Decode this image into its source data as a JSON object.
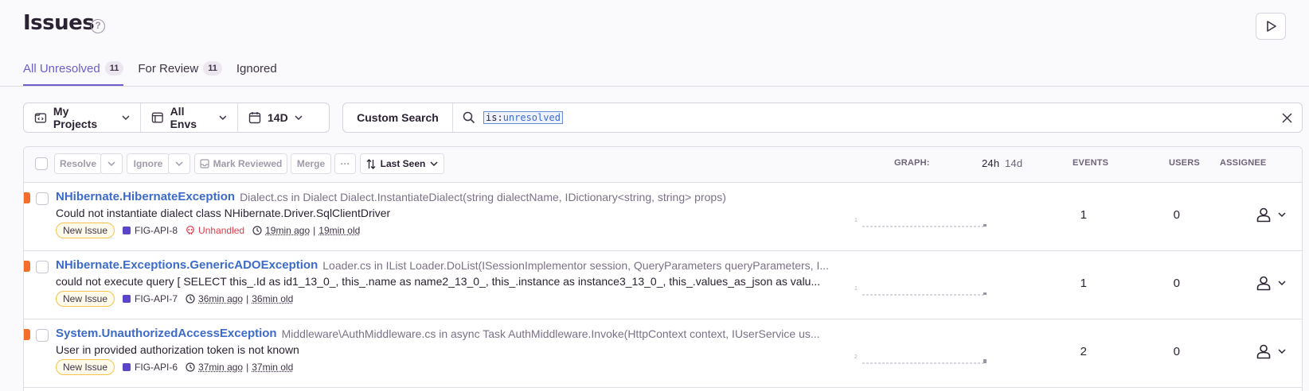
{
  "header": {
    "title": "Issues",
    "help_icon": "question-circle-icon",
    "play_icon": "play-icon"
  },
  "tabs": [
    {
      "label": "All Unresolved",
      "count": "11",
      "active": true
    },
    {
      "label": "For Review",
      "count": "11",
      "active": false
    },
    {
      "label": "Ignored",
      "count": "",
      "active": false
    }
  ],
  "filters": {
    "projects": "My Projects",
    "envs": "All Envs",
    "period": "14D"
  },
  "search": {
    "custom_label": "Custom Search",
    "query_key": "is:",
    "query_value": "unresolved"
  },
  "toolbar": {
    "resolve": "Resolve",
    "ignore": "Ignore",
    "mark_reviewed": "Mark Reviewed",
    "merge": "Merge",
    "more": "···",
    "sort": "Last Seen"
  },
  "columns": {
    "graph": "GRAPH:",
    "graph_24h": "24h",
    "graph_14d": "14d",
    "events": "EVENTS",
    "users": "USERS",
    "assignee": "ASSIGNEE"
  },
  "issues": [
    {
      "title": "NHibernate.HibernateException",
      "culprit": "Dialect.cs in Dialect Dialect.InstantiateDialect(string dialectName, IDictionary<string, string> props)",
      "message": "Could not instantiate dialect class NHibernate.Driver.SqlClientDriver",
      "badge": "New Issue",
      "short_id": "FIG-API-8",
      "unhandled": "Unhandled",
      "last_seen": "19min ago",
      "age": "19min old",
      "graph_max": "1",
      "events": "1",
      "users": "0"
    },
    {
      "title": "NHibernate.Exceptions.GenericADOException",
      "culprit": "Loader.cs in IList Loader.DoList(ISessionImplementor session, QueryParameters queryParameters, I...",
      "message": "could not execute query [ SELECT this_.Id as id1_13_0_, this_.name as name2_13_0_, this_.instance as instance3_13_0_, this_.values_as_json as valu...",
      "badge": "New Issue",
      "short_id": "FIG-API-7",
      "unhandled": "",
      "last_seen": "36min ago",
      "age": "36min old",
      "graph_max": "1",
      "events": "1",
      "users": "0"
    },
    {
      "title": "System.UnauthorizedAccessException",
      "culprit": "Middleware\\AuthMiddleware.cs in async Task AuthMiddleware.Invoke(HttpContext context, IUserService us...",
      "message": "User in provided authorization token is not known",
      "badge": "New Issue",
      "short_id": "FIG-API-6",
      "unhandled": "",
      "last_seen": "37min ago",
      "age": "37min old",
      "graph_max": "2",
      "events": "2",
      "users": "0"
    }
  ],
  "colors": {
    "accent": "#6c5fc7",
    "link": "#3c6bc9",
    "level_error": "#f36e2a",
    "unhandled": "#e23a4a"
  }
}
